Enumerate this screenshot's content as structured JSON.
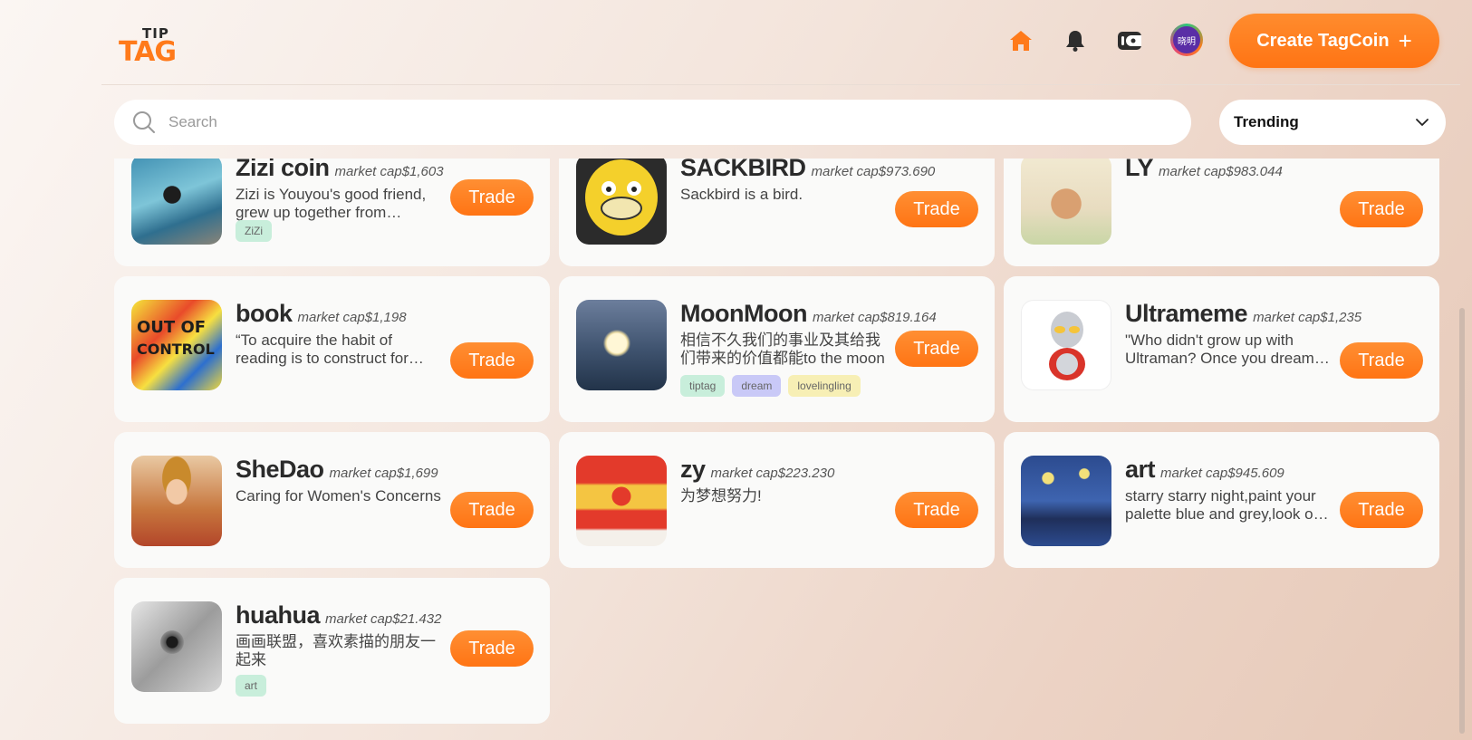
{
  "header": {
    "logo_top": "TIP",
    "logo_bottom": "TAG",
    "avatar_text": "晓明",
    "create_label": "Create TagCoin",
    "create_plus": "+"
  },
  "search": {
    "placeholder": "Search",
    "value": ""
  },
  "sort": {
    "selected": "Trending"
  },
  "trade_label": "Trade",
  "cards": [
    {
      "name": "Zizi coin",
      "cap": "market cap$1,603",
      "desc": "Zizi is Youyou's good friend, grew up together from childhood.",
      "tags": [
        "ZiZi"
      ]
    },
    {
      "name": "SACKBIRD",
      "cap": "market cap$973.690",
      "desc": "Sackbird is a bird.",
      "tags": []
    },
    {
      "name": "LY",
      "cap": "market cap$983.044",
      "desc": "",
      "tags": []
    },
    {
      "name": "book",
      "cap": "market cap$1,198",
      "desc": "“To acquire the habit of reading is to construct for yourself a refuge from almost all the miseries of life.”",
      "tags": []
    },
    {
      "name": "MoonMoon",
      "cap": "market cap$819.164",
      "desc": "相信不久我们的事业及其给我们带来的价值都能to the moon",
      "tags": [
        "tiptag",
        "dream",
        "lovelingling"
      ]
    },
    {
      "name": "Ultrameme",
      "cap": "market cap$1,235",
      "desc": "\"Who didn't grow up with Ultraman? Once you dream it, you can be it.",
      "tags": []
    },
    {
      "name": "SheDao",
      "cap": "market cap$1,699",
      "desc": "Caring for Women's Concerns",
      "tags": []
    },
    {
      "name": "zy",
      "cap": "market cap$223.230",
      "desc": "为梦想努力!",
      "tags": []
    },
    {
      "name": "art",
      "cap": "market cap$945.609",
      "desc": "starry starry night,paint your palette blue and grey,look out on a summer's day",
      "tags": []
    },
    {
      "name": "huahua",
      "cap": "market cap$21.432",
      "desc": "画画联盟，喜欢素描的朋友一起来",
      "tags": [
        "art"
      ]
    }
  ],
  "colors": {
    "accent": "#ff7a1a",
    "tag_green": "#c8eedb",
    "tag_purple": "#c9c9f7",
    "tag_yellow": "#f7efb5"
  },
  "icons": [
    "home-icon",
    "bell-icon",
    "wallet-icon",
    "search-icon",
    "chevron-down-icon",
    "plus-icon"
  ]
}
